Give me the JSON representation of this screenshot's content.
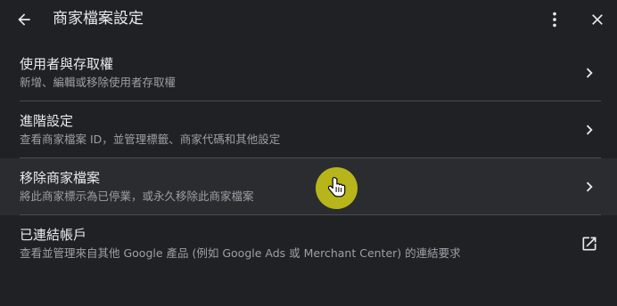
{
  "header": {
    "back_icon": "arrow-left-icon",
    "title": "商家檔案設定",
    "more_icon": "more-vert-icon",
    "close_icon": "close-icon"
  },
  "items": [
    {
      "title": "使用者與存取權",
      "subtitle": "新增、編輯或移除使用者存取權",
      "icon": "chevron-right-icon"
    },
    {
      "title": "進階設定",
      "subtitle": "查看商家檔案 ID，並管理標籤、商家代碼和其他設定",
      "icon": "chevron-right-icon"
    },
    {
      "title": "移除商家檔案",
      "subtitle": "將此商家標示為已停業，或永久移除此商家檔案",
      "icon": "chevron-right-icon"
    },
    {
      "title": "已連結帳戶",
      "subtitle": "查看並管理來自其他 Google 產品 (例如 Google Ads 或 Merchant Center) 的連結要求",
      "icon": "open-in-new-icon"
    }
  ],
  "colors": {
    "background": "#202124",
    "hover_row": "#2b2c2f",
    "text_primary": "#e8eaed",
    "text_secondary": "#9aa0a6",
    "cursor_highlight": "#b7b51a"
  }
}
